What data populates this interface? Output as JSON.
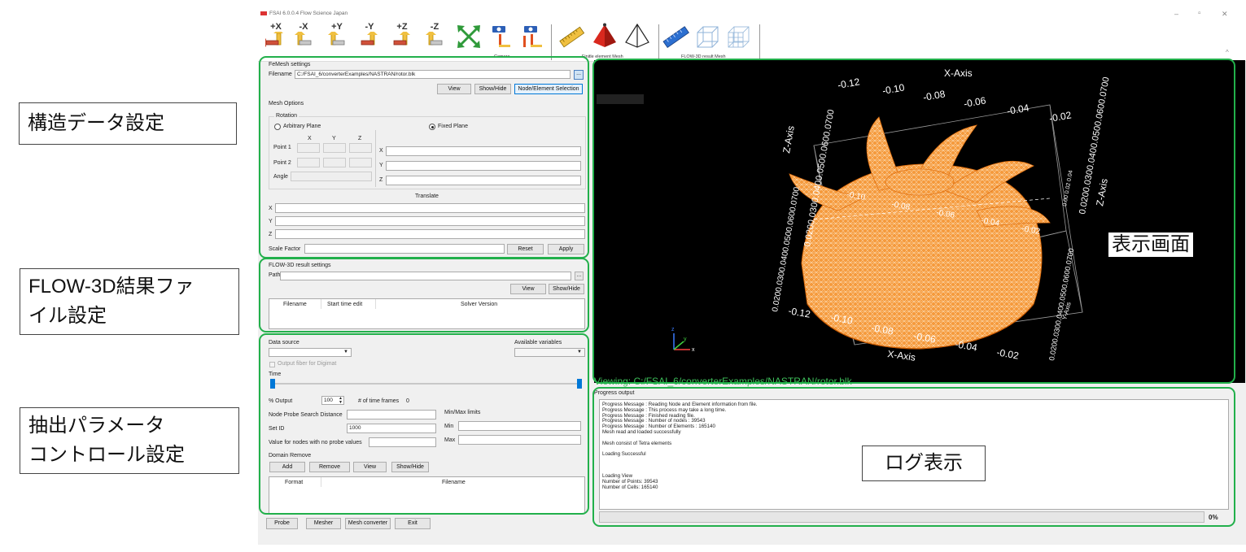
{
  "window": {
    "title": "FSAI 6.0.0.4 Flow Science Japan",
    "min": "–",
    "max": "▫",
    "close": "✕",
    "collapse": "^"
  },
  "toolbar": {
    "view_buttons": [
      "+X",
      "-X",
      "+Y",
      "-Y",
      "+Z",
      "-Z"
    ],
    "camera_caption": "Camera",
    "fe_caption": "Finitle element Mesh",
    "flow_caption": "FLOW-3D result Mesh"
  },
  "femesh": {
    "title": "FeMesh settings",
    "filename_label": "Filename",
    "filename_value": "C:/FSAI_6/converterExamples/NASTRAN/rotor.blk",
    "browse": "...",
    "view": "View",
    "show_hide": "Show/Hide",
    "node_selection": "Node/Element Selection",
    "mesh_options": "Mesh Options",
    "rotation": "Rotation",
    "arbitrary_plane": "Arbitrary Plane",
    "fixed_plane": "Fixed Plane",
    "col_x": "X",
    "col_y": "Y",
    "col_z": "Z",
    "point1": "Point 1",
    "point2": "Point 2",
    "angle": "Angle",
    "fx": "X",
    "fy": "Y",
    "fz": "Z",
    "translate": "Translate",
    "tx": "X",
    "ty": "Y",
    "tz": "Z",
    "scale_factor": "Scale Factor",
    "reset": "Reset",
    "apply": "Apply"
  },
  "flow3d": {
    "title": "FLOW-3D result settings",
    "path_label": "Path",
    "browse": "...",
    "view": "View",
    "show_hide": "Show/Hide",
    "col_filename": "Filename",
    "col_start": "Start time edit",
    "col_solver": "Solver Version"
  },
  "extract": {
    "data_source": "Data source",
    "available_variables": "Available variables",
    "output_fiber": "Output fiber for Digimat",
    "time": "Time",
    "pct_output": "% Output",
    "pct_value": "100",
    "time_frames": "# of time frames",
    "time_frames_value": "0",
    "node_probe": "Node Probe Search Distance",
    "set_id": "Set ID",
    "set_id_value": "1000",
    "no_probe": "Value for nodes with no probe values",
    "minmax": "Min/Max limits",
    "min": "Min",
    "max": "Max",
    "domain_remove": "Domain Remove",
    "add": "Add",
    "remove": "Remove",
    "view": "View",
    "show_hide": "Show/Hide",
    "col_format": "Format",
    "col_filename": "Filename"
  },
  "bottom_buttons": [
    "Probe",
    "Mesher",
    "Mesh converter",
    "Exit"
  ],
  "viewport": {
    "x_axis": "X-Axis",
    "z_axis": "Z-Axis",
    "y_axis": "Y-Axis",
    "top_ticks": [
      "-0.12",
      "-0.10",
      "-0.08",
      "-0.06",
      "-0.04",
      "-0.02"
    ],
    "bottom_ticks": [
      "-0.12",
      "-0.10",
      "-0.08",
      "-0.06",
      "-0.04",
      "-0.02"
    ],
    "inner_ticks": [
      "-0.10",
      "-0.08",
      "-0.06",
      "-0.04",
      "-0.02"
    ],
    "left_ticks": "0.0200.0300.0400.0500.0600.0700",
    "right_ticks": "0.0200.0300.0400.0500.0600.0700",
    "side_ticks": "0.00 0.02 0.04",
    "viewing": "Viewing: C:/FSAI_6/converterExamples/NASTRAN/rotor.blk",
    "mesh_color": "#f59a3c",
    "tri_x": "x",
    "tri_y": "y",
    "tri_z": "z"
  },
  "log": {
    "title": "Progress output",
    "lines": [
      "Progress Message : Reading Node and Element information from file.",
      "Progress Message : This process may take a long time.",
      "Progress Message : Finished reading file.",
      "Progress Message : Number of nodes : 39543",
      "Progress Message : Number of Elements : 165140",
      "Mesh read and loaded successfully",
      "",
      "Mesh consist of Tetra elements",
      "",
      "Loading Successful",
      "",
      "",
      "",
      "Loading View",
      "Number of Points: 39543",
      "Number of Cells: 165140"
    ],
    "progress": "0%"
  },
  "callouts": {
    "structure": "構造データ設定",
    "flow_line1": "FLOW-3D結果ファ",
    "flow_line2": "イル設定",
    "extract_line1": "抽出パラメータ",
    "extract_line2": "コントロール設定",
    "display": "表示画面",
    "log": "ログ表示"
  },
  "colors": {
    "highlight": "#22b04b",
    "accent": "#cce4f7"
  }
}
